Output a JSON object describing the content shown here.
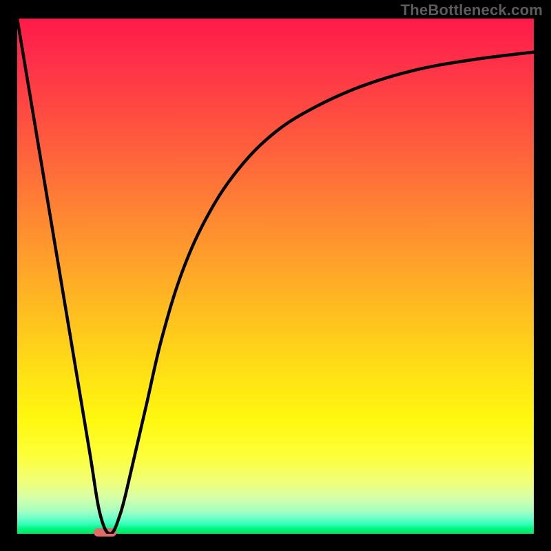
{
  "watermark": "TheBottleneck.com",
  "colors": {
    "frame": "#000000",
    "curve": "#000000",
    "marker": "#e06868",
    "watermark": "#5c5c5c"
  },
  "chart_data": {
    "type": "line",
    "title": "",
    "xlabel": "",
    "ylabel": "",
    "xlim": [
      0,
      100
    ],
    "ylim": [
      0,
      100
    ],
    "grid": false,
    "legend": false,
    "background_gradient": {
      "top": "red",
      "bottom": "green",
      "meaning": "high-y is worse (red), low-y is better (green)"
    },
    "series": [
      {
        "name": "curve",
        "x": [
          0,
          5,
          10,
          14,
          16,
          18,
          20,
          22,
          25,
          28,
          32,
          37,
          43,
          50,
          58,
          67,
          77,
          88,
          100
        ],
        "y": [
          100,
          70,
          40,
          16,
          4,
          0,
          4,
          12,
          25,
          38,
          51,
          62,
          71,
          78,
          83,
          87,
          90,
          92,
          93.5
        ]
      }
    ],
    "minimum_marker": {
      "x_center": 17,
      "x_width": 4.5,
      "y": 0
    }
  }
}
